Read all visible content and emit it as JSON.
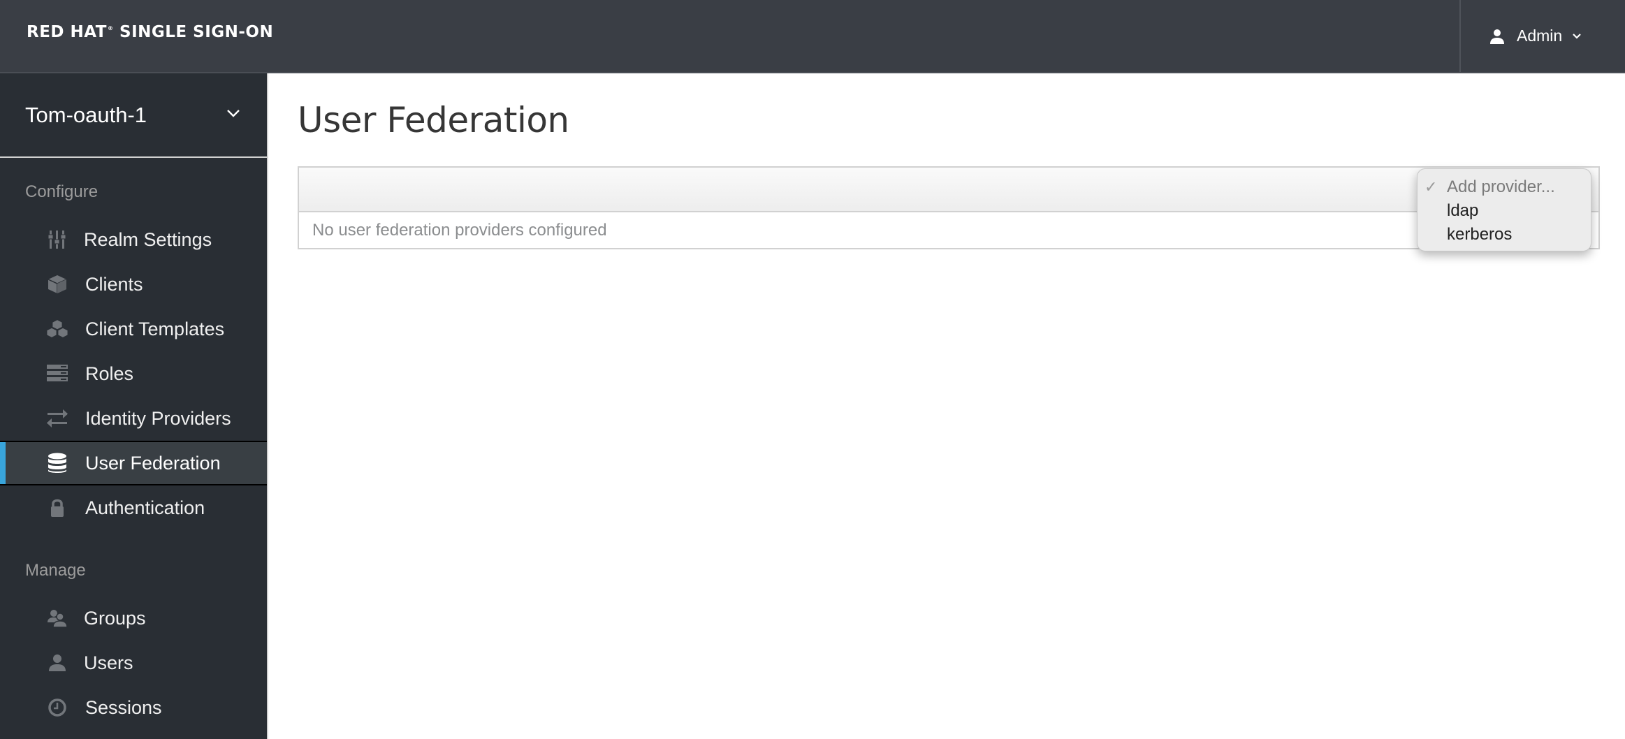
{
  "header": {
    "brand": "RED HAT",
    "brand_mark": "®",
    "product": "SINGLE SIGN-ON",
    "user_label": "Admin",
    "user_icon": "user-icon",
    "user_chevron_icon": "chevron-down-icon"
  },
  "sidebar": {
    "realm": "Tom-oauth-1",
    "realm_chevron_icon": "chevron-down-icon",
    "sections": [
      {
        "title": "Configure",
        "items": [
          {
            "label": "Realm Settings",
            "icon": "sliders-icon",
            "active": false
          },
          {
            "label": "Clients",
            "icon": "cube-icon",
            "active": false
          },
          {
            "label": "Client Templates",
            "icon": "cubes-icon",
            "active": false
          },
          {
            "label": "Roles",
            "icon": "list-icon",
            "active": false
          },
          {
            "label": "Identity Providers",
            "icon": "exchange-icon",
            "active": false
          },
          {
            "label": "User Federation",
            "icon": "database-icon",
            "active": true
          },
          {
            "label": "Authentication",
            "icon": "lock-icon",
            "active": false
          }
        ]
      },
      {
        "title": "Manage",
        "items": [
          {
            "label": "Groups",
            "icon": "users-icon",
            "active": false
          },
          {
            "label": "Users",
            "icon": "user-icon",
            "active": false
          },
          {
            "label": "Sessions",
            "icon": "clock-icon",
            "active": false
          }
        ]
      }
    ]
  },
  "main": {
    "title": "User Federation",
    "empty_message": "No user federation providers configured",
    "add_provider": {
      "selected": "Add provider...",
      "options": [
        "Add provider...",
        "ldap",
        "kerberos"
      ]
    }
  },
  "colors": {
    "header_bg": "#3a3e45",
    "sidebar_bg": "#292e34",
    "active_accent": "#39a5dc"
  }
}
